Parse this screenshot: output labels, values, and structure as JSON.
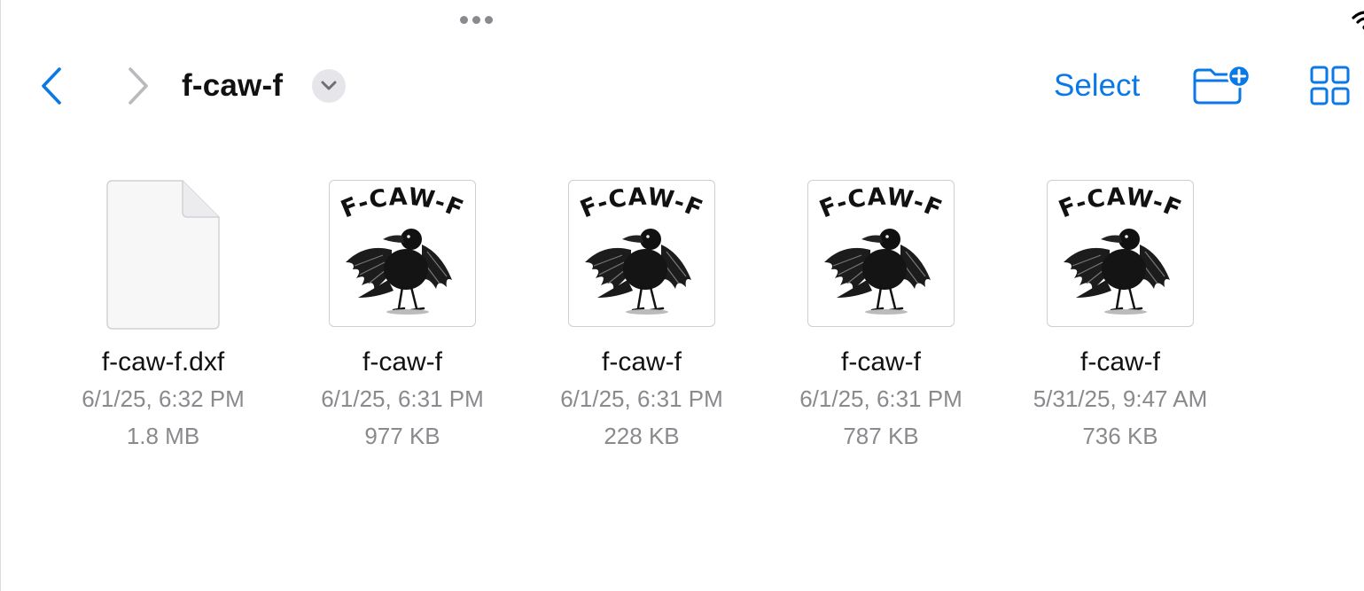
{
  "colors": {
    "accent": "#0a78e6",
    "secondary_text": "#8a8a8e",
    "primary_text": "#111111"
  },
  "toolbar": {
    "back_icon": "chevron-left-icon",
    "forward_icon": "chevron-right-icon",
    "title": "f-caw-f",
    "title_menu_icon": "chevron-down-icon",
    "select_label": "Select",
    "new_folder_icon": "folder-badge-plus-icon",
    "view_icon": "grid-view-icon"
  },
  "thumbnail_text": "F-CAW-F",
  "files": [
    {
      "name": "f-caw-f.dxf",
      "date": "6/1/25, 6:32 PM",
      "size": "1.8 MB",
      "kind": "document"
    },
    {
      "name": "f-caw-f",
      "date": "6/1/25, 6:31 PM",
      "size": "977 KB",
      "kind": "image"
    },
    {
      "name": "f-caw-f",
      "date": "6/1/25, 6:31 PM",
      "size": "228 KB",
      "kind": "image"
    },
    {
      "name": "f-caw-f",
      "date": "6/1/25, 6:31 PM",
      "size": "787 KB",
      "kind": "image"
    },
    {
      "name": "f-caw-f",
      "date": "5/31/25, 9:47 AM",
      "size": "736 KB",
      "kind": "image"
    }
  ]
}
